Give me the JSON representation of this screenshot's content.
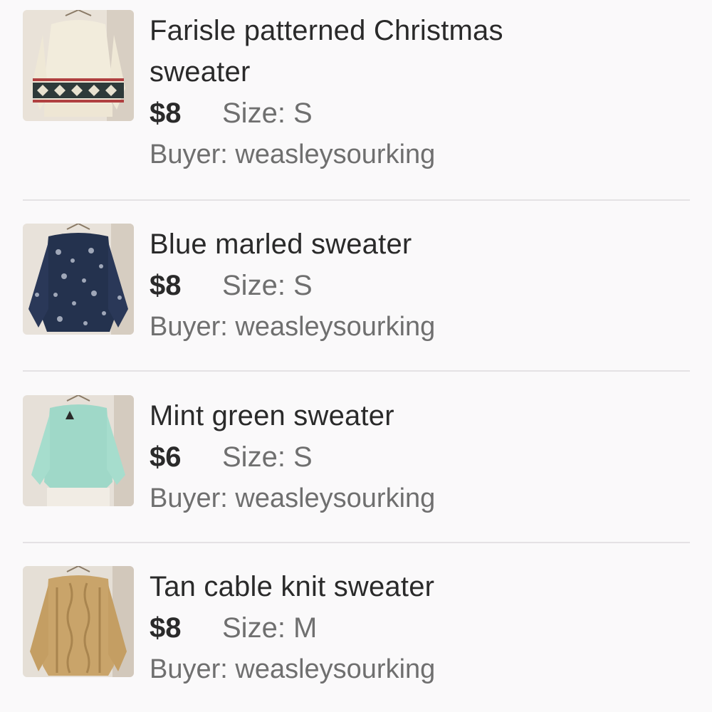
{
  "items": [
    {
      "title_line1": "Farisle patterned Christmas",
      "title_line2": "sweater",
      "price": "$8",
      "size": "Size: S",
      "buyer": "Buyer: weasleysourking",
      "image": "cream-fairisle-sweater-photo"
    },
    {
      "title_line1": "Blue marled sweater",
      "price": "$8",
      "size": "Size: S",
      "buyer": "Buyer: weasleysourking",
      "image": "blue-marled-sweater-photo"
    },
    {
      "title_line1": "Mint green sweater",
      "price": "$6",
      "size": "Size: S",
      "buyer": "Buyer: weasleysourking",
      "image": "mint-green-sweater-photo"
    },
    {
      "title_line1": "Tan cable knit sweater",
      "price": "$8",
      "size": "Size: M",
      "buyer": "Buyer: weasleysourking",
      "image": "tan-cable-knit-sweater-photo"
    }
  ],
  "colors": {
    "background": "#faf9fa",
    "title_text": "#2a2a2a",
    "secondary_text": "#6f6f6f",
    "divider": "#e4e2e4"
  }
}
